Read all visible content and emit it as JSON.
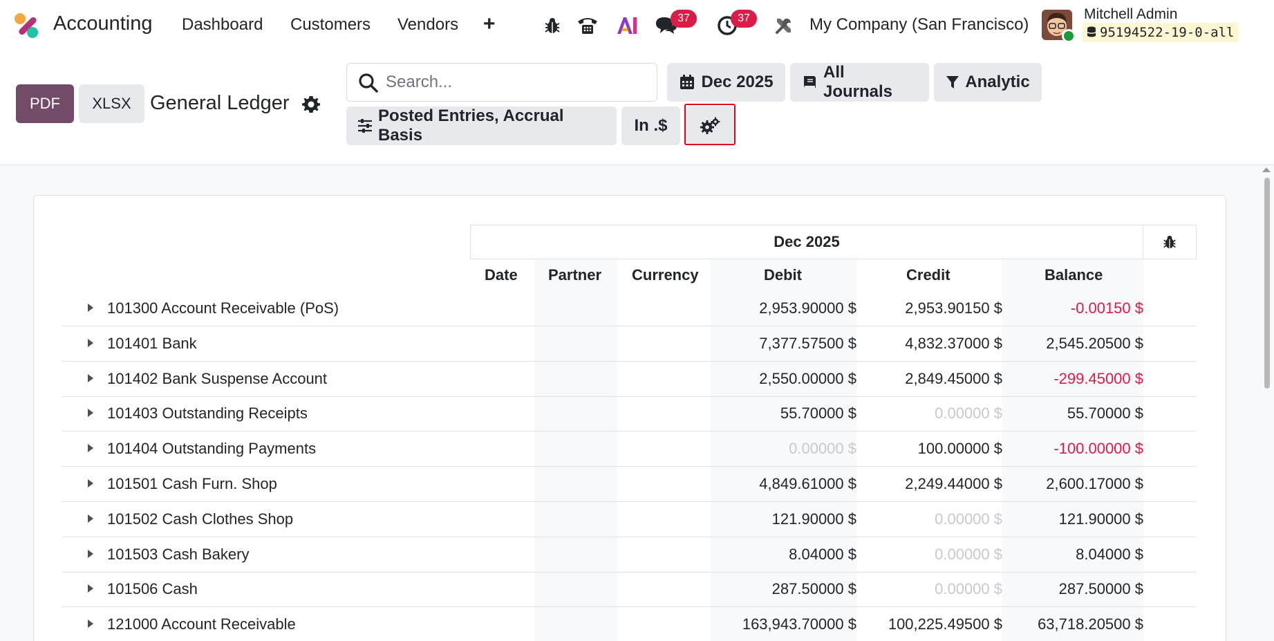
{
  "navbar": {
    "app_title": "Accounting",
    "menu": [
      "Dashboard",
      "Customers",
      "Vendors"
    ],
    "messages_badge": "37",
    "activities_badge": "37",
    "company": "My Company (San Francisco)",
    "user_name": "Mitchell Admin",
    "database": "95194522-19-0-all"
  },
  "control_panel": {
    "pdf_label": "PDF",
    "xlsx_label": "XLSX",
    "page_title": "General Ledger",
    "search_placeholder": "Search...",
    "filters": {
      "date": "Dec 2025",
      "journals": "All Journals",
      "analytic": "Analytic",
      "options": "Posted Entries, Accrual Basis",
      "currency": "In .$"
    }
  },
  "report": {
    "period": "Dec 2025",
    "columns": [
      "Date",
      "Partner",
      "Currency",
      "Debit",
      "Credit",
      "Balance"
    ],
    "rows": [
      {
        "account": "101300 Account Receivable (PoS)",
        "debit": "2,953.90000 $",
        "credit": "2,953.90150 $",
        "balance": "-0.00150 $"
      },
      {
        "account": "101401 Bank",
        "debit": "7,377.57500 $",
        "credit": "4,832.37000 $",
        "balance": "2,545.20500 $"
      },
      {
        "account": "101402 Bank Suspense Account",
        "debit": "2,550.00000 $",
        "credit": "2,849.45000 $",
        "balance": "-299.45000 $"
      },
      {
        "account": "101403 Outstanding Receipts",
        "debit": "55.70000 $",
        "credit": "0.00000 $",
        "balance": "55.70000 $"
      },
      {
        "account": "101404 Outstanding Payments",
        "debit": "0.00000 $",
        "credit": "100.00000 $",
        "balance": "-100.00000 $"
      },
      {
        "account": "101501 Cash Furn. Shop",
        "debit": "4,849.61000 $",
        "credit": "2,249.44000 $",
        "balance": "2,600.17000 $"
      },
      {
        "account": "101502 Cash Clothes Shop",
        "debit": "121.90000 $",
        "credit": "0.00000 $",
        "balance": "121.90000 $"
      },
      {
        "account": "101503 Cash Bakery",
        "debit": "8.04000 $",
        "credit": "0.00000 $",
        "balance": "8.04000 $"
      },
      {
        "account": "101506 Cash",
        "debit": "287.50000 $",
        "credit": "0.00000 $",
        "balance": "287.50000 $"
      },
      {
        "account": "121000 Account Receivable",
        "debit": "163,943.70000 $",
        "credit": "100,225.49500 $",
        "balance": "63,718.20500 $"
      }
    ]
  },
  "colors": {
    "brand": "#714b67",
    "badge": "#dc1c47",
    "negative": "#dc1c47",
    "zero": "#c6c9cd",
    "highlight": "#e0001b"
  }
}
